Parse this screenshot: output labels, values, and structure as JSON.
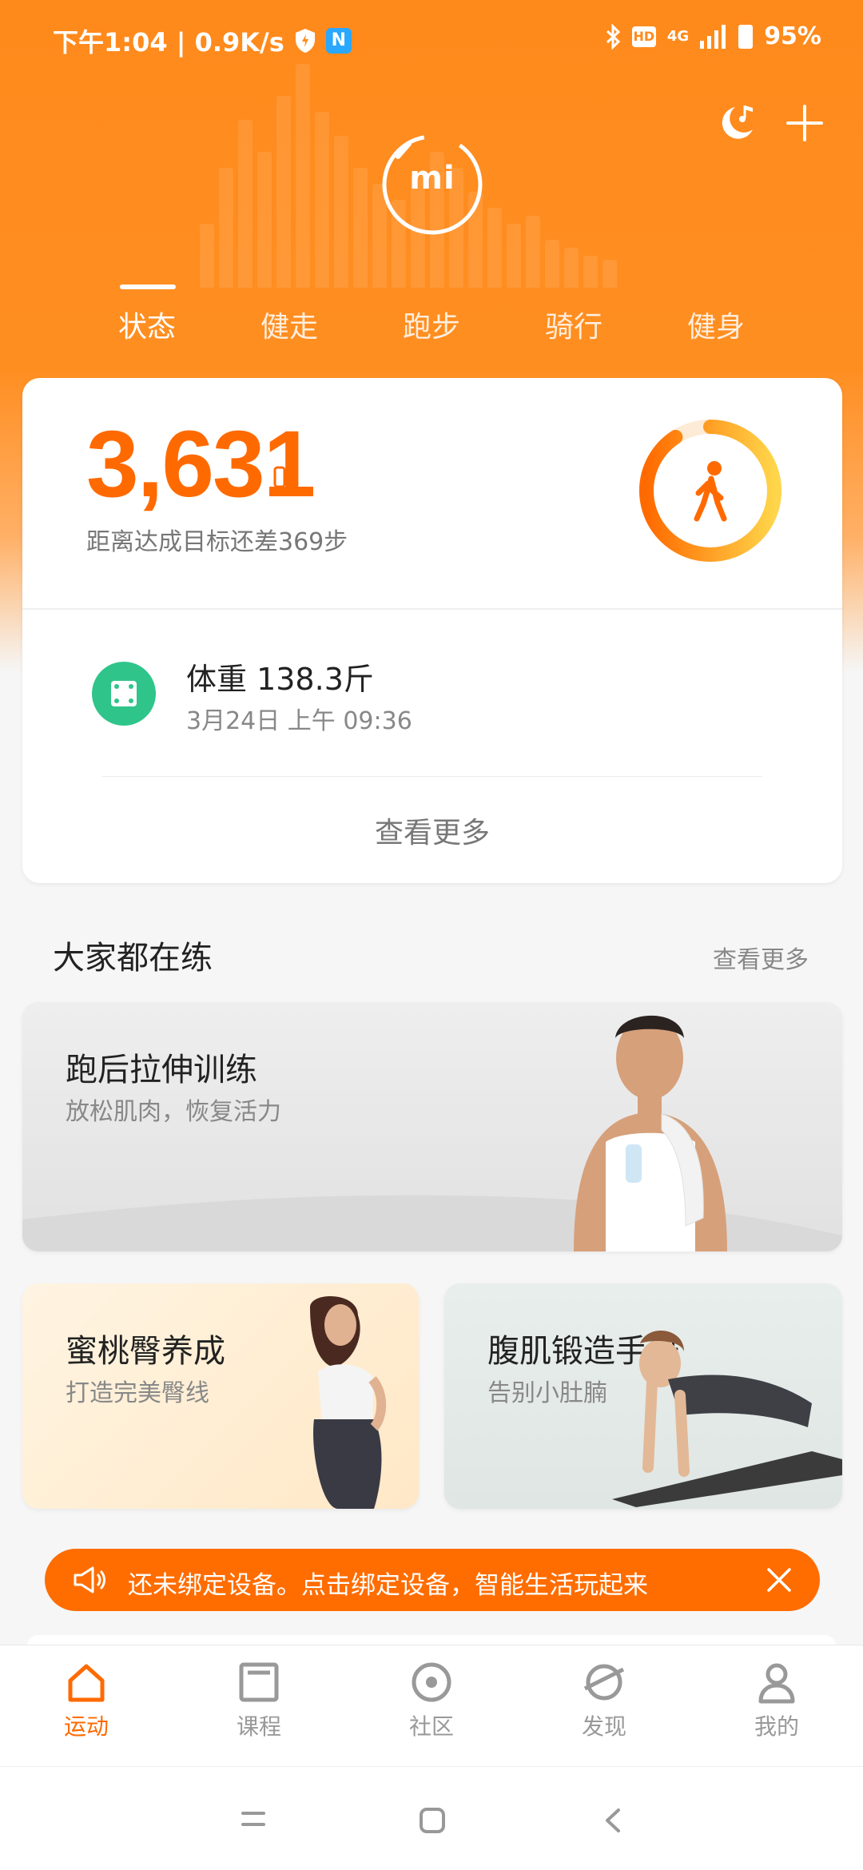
{
  "status_bar": {
    "time_speed": "下午1:04 | 0.9K/s",
    "nfc_label": "N",
    "hd_label": "HD",
    "network": "4G",
    "battery": "95%"
  },
  "header": {
    "logo_text": "mi",
    "tabs": [
      {
        "label": "状态",
        "active": true
      },
      {
        "label": "健走",
        "active": false
      },
      {
        "label": "跑步",
        "active": false
      },
      {
        "label": "骑行",
        "active": false
      },
      {
        "label": "健身",
        "active": false
      }
    ]
  },
  "status_card": {
    "steps": "3,631",
    "remaining_text": "距离达成目标还差369步",
    "goal_progress": 0.908,
    "weight_title": "体重  138.3斤",
    "weight_date": "3月24日  上午  09:36",
    "see_more": "查看更多"
  },
  "section": {
    "title": "大家都在练",
    "see_more": "查看更多"
  },
  "promos": [
    {
      "title": "跑后拉伸训练",
      "subtitle": "放松肌肉，恢复活力"
    },
    {
      "title": "蜜桃臀养成",
      "subtitle": "打造完美臀线"
    },
    {
      "title": "腹肌锻造手册",
      "subtitle": "告别小肚腩"
    }
  ],
  "notice": {
    "text": "还未绑定设备。点击绑定设备，智能生活玩起来"
  },
  "bottom_nav": [
    {
      "label": "运动",
      "icon": "home-icon",
      "active": true
    },
    {
      "label": "课程",
      "icon": "course-icon",
      "active": false
    },
    {
      "label": "社区",
      "icon": "community-icon",
      "active": false
    },
    {
      "label": "发现",
      "icon": "discover-icon",
      "active": false
    },
    {
      "label": "我的",
      "icon": "profile-icon",
      "active": false
    }
  ],
  "colors": {
    "accent": "#ff6a00",
    "header": "#ff8a1c",
    "weight_icon": "#2fc58a"
  }
}
